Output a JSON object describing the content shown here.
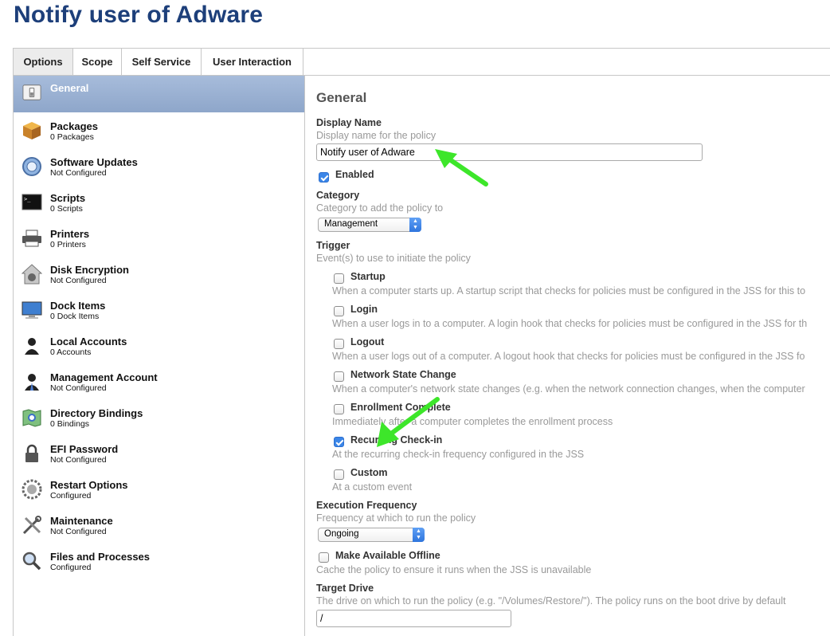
{
  "page": {
    "title": "Notify user of Adware"
  },
  "tabs": [
    "Options",
    "Scope",
    "Self Service",
    "User Interaction"
  ],
  "sidebar": [
    {
      "label": "General",
      "sub": "",
      "icon": "switch-icon"
    },
    {
      "label": "Packages",
      "sub": "0 Packages",
      "icon": "package-icon"
    },
    {
      "label": "Software Updates",
      "sub": "Not Configured",
      "icon": "software-update-icon"
    },
    {
      "label": "Scripts",
      "sub": "0 Scripts",
      "icon": "terminal-icon"
    },
    {
      "label": "Printers",
      "sub": "0 Printers",
      "icon": "printer-icon"
    },
    {
      "label": "Disk Encryption",
      "sub": "Not Configured",
      "icon": "disk-encryption-icon"
    },
    {
      "label": "Dock Items",
      "sub": "0 Dock Items",
      "icon": "dock-icon"
    },
    {
      "label": "Local Accounts",
      "sub": "0 Accounts",
      "icon": "user-icon"
    },
    {
      "label": "Management Account",
      "sub": "Not Configured",
      "icon": "management-user-icon"
    },
    {
      "label": "Directory Bindings",
      "sub": "0 Bindings",
      "icon": "directory-icon"
    },
    {
      "label": "EFI Password",
      "sub": "Not Configured",
      "icon": "lock-icon"
    },
    {
      "label": "Restart Options",
      "sub": "Configured",
      "icon": "restart-icon"
    },
    {
      "label": "Maintenance",
      "sub": "Not Configured",
      "icon": "tools-icon"
    },
    {
      "label": "Files and Processes",
      "sub": "Configured",
      "icon": "magnifier-icon"
    }
  ],
  "general": {
    "title": "General",
    "display_name": {
      "label": "Display Name",
      "desc": "Display name for the policy",
      "value": "Notify user of Adware"
    },
    "enabled": {
      "label": "Enabled",
      "checked": true
    },
    "category": {
      "label": "Category",
      "desc": "Category to add the policy to",
      "value": "Management"
    },
    "trigger": {
      "label": "Trigger",
      "desc": "Event(s) to use to initiate the policy",
      "options": [
        {
          "label": "Startup",
          "desc": "When a computer starts up. A startup script that checks for policies must be configured in the JSS for this to",
          "checked": false
        },
        {
          "label": "Login",
          "desc": "When a user logs in to a computer. A login hook that checks for policies must be configured in the JSS for th",
          "checked": false
        },
        {
          "label": "Logout",
          "desc": "When a user logs out of a computer. A logout hook that checks for policies must be configured in the JSS fo",
          "checked": false
        },
        {
          "label": "Network State Change",
          "desc": "When a computer's network state changes (e.g. when the network connection changes, when the computer",
          "checked": false
        },
        {
          "label": "Enrollment Complete",
          "desc": "Immediately after a computer completes the enrollment process",
          "checked": false
        },
        {
          "label": "Recurring Check-in",
          "desc": "At the recurring check-in frequency configured in the JSS",
          "checked": true
        },
        {
          "label": "Custom",
          "desc": "At a custom event",
          "checked": false
        }
      ]
    },
    "frequency": {
      "label": "Execution Frequency",
      "desc": "Frequency at which to run the policy",
      "value": "Ongoing"
    },
    "offline": {
      "label": "Make Available Offline",
      "desc": "Cache the policy to ensure it runs when the JSS is unavailable",
      "checked": false
    },
    "target_drive": {
      "label": "Target Drive",
      "desc": "The drive on which to run the policy (e.g. \"/Volumes/Restore/\"). The policy runs on the boot drive by default",
      "value": "/"
    }
  },
  "colors": {
    "title": "#1d3f7a",
    "accent": "#3b86e8",
    "sidebar_active": "#9bb2d4",
    "annotation_arrow": "#3de62a"
  }
}
